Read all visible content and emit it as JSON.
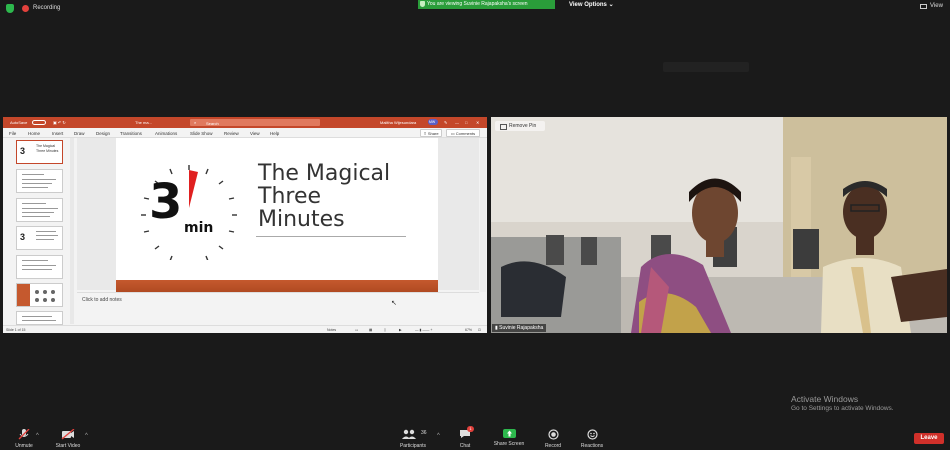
{
  "top": {
    "recording_label": "Recording",
    "viewing_banner": "You are viewing Suvinie Rajapaksha's screen",
    "view_options_label": "View Options",
    "view_label": "View"
  },
  "shared_screen": {
    "app": {
      "autosave_label": "AutoSave",
      "doc_title": "The ma...",
      "search_placeholder": "Search",
      "user_name": "Malitha Wijesundara",
      "user_initials": "MW"
    },
    "ribbon_tabs": [
      "File",
      "Home",
      "Insert",
      "Draw",
      "Design",
      "Transitions",
      "Animations",
      "Slide Show",
      "Review",
      "View",
      "Help"
    ],
    "share_label": "Share",
    "comments_label": "Comments",
    "thumb_numbers": [
      "1",
      "2",
      "3",
      "4",
      "5",
      "6",
      "7"
    ],
    "thumb1_text": "The Magical Three Minutes",
    "slide": {
      "title_line1": "The Magical",
      "title_line2": "Three",
      "title_line3": "Minutes",
      "timer_number": "3",
      "timer_unit": "min"
    },
    "notes_placeholder": "Click to add notes",
    "status": {
      "slide_counter": "Slide 1 of 15",
      "notes_label": "Notes",
      "zoom": "67%"
    }
  },
  "video": {
    "remove_pin_label": "Remove Pin",
    "participant_name": "Suvinie Rajapaksha"
  },
  "toolbar": {
    "unmute_label": "Unmute",
    "start_video_label": "Start Video",
    "participants_label": "Participants",
    "participants_count": "36",
    "chat_label": "Chat",
    "chat_badge": "1",
    "share_screen_label": "Share Screen",
    "record_label": "Record",
    "reactions_label": "Reactions",
    "leave_label": "Leave"
  },
  "watermark": {
    "line1": "Activate Windows",
    "line2": "Go to Settings to activate Windows."
  },
  "colors": {
    "ppt_accent": "#c4472a",
    "share_green": "#2db84d",
    "leave_red": "#d0302a"
  }
}
